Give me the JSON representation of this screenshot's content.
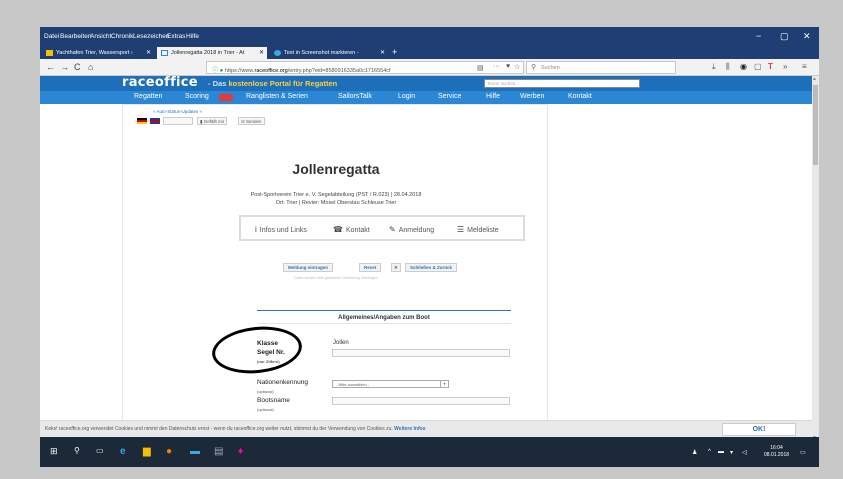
{
  "menubar": {
    "items": [
      "Datei",
      "Bearbeiten",
      "Ansicht",
      "Chronik",
      "Lesezeichen",
      "Extras",
      "Hilfe"
    ],
    "minimize": "−",
    "maximize": "▢",
    "close": "✕"
  },
  "tabs": [
    {
      "label": "Yachthafen Trier, Wassersport ›",
      "close": "✕"
    },
    {
      "label": "Jollenregatta 2018 in Trier - At",
      "close": "✕"
    },
    {
      "label": "Text in Screenshot markieren -",
      "close": "✕"
    }
  ],
  "new_tab": "+",
  "nav": {
    "back": "←",
    "forward": "→",
    "reload": "C",
    "home": "⌂",
    "url_prefix": "https://www.",
    "url_domain": "raceoffice.org",
    "url_path": "/entry.php?eid=8580916335a0c1716554cf",
    "url_more": "···",
    "search_placeholder": "Suchen",
    "menu": "≡"
  },
  "site": {
    "logo": "raceoffice",
    "tagline_a": "- Das ",
    "tagline_b": "kostenlose Portal für Regatten",
    "search_placeholder": "Event suchen...",
    "nav": [
      "Regatten",
      "Scoring",
      "Ranglisten & Serien",
      "SailorsTalk",
      "Login",
      "Service",
      "Hilfe",
      "Werben",
      "Kontakt"
    ]
  },
  "page": {
    "auto_status": "» Auto-Status-Updates «",
    "like": "Gefällt mir",
    "send": "Senden",
    "title": "Jollenregatta",
    "sub1": "Post-Sportverein Trier e. V. Segelabteilung (PST / R.023) | 28.04.2018",
    "sub2": "Ort: Trier | Revier: Mosel Oberstau Schleuse Trier",
    "tabs": [
      {
        "icon": "i",
        "label": "Infos und Links"
      },
      {
        "icon": "☎",
        "label": "Kontakt"
      },
      {
        "icon": "✎",
        "label": "Anmeldung"
      },
      {
        "icon": "☰",
        "label": "Meldeliste"
      }
    ],
    "buttons": [
      "Meldung eintragen",
      "Reset",
      "Schließen & Zurück"
    ],
    "buttons_note": "Daten werden über gesicherte Verbindung übertragen",
    "section": "Allgemeines/Angaben zum Boot",
    "fields": {
      "klasse": "Klasse",
      "klasse_value": "Jollen",
      "segelnr": "Segel Nr.",
      "segelnr_note": "(nur Ziffern)",
      "nation": "Nationenkennung",
      "nation_note": "(optional)",
      "nation_select": "- Bitte auswählen -",
      "bootsname": "Bootsname",
      "bootsname_note": "(optional)"
    }
  },
  "cookie": {
    "text": "Keks! raceoffice.org verwendet Cookies und nimmt den Datenschutz ernst - wenn du raceoffice.org weiter nutzt, stimmst du der Verwendung von Cookies zu. ",
    "more": "Weitere Infos",
    "ok": "OK!"
  },
  "taskbar": {
    "time": "16:04",
    "date": "08.01.2018"
  }
}
